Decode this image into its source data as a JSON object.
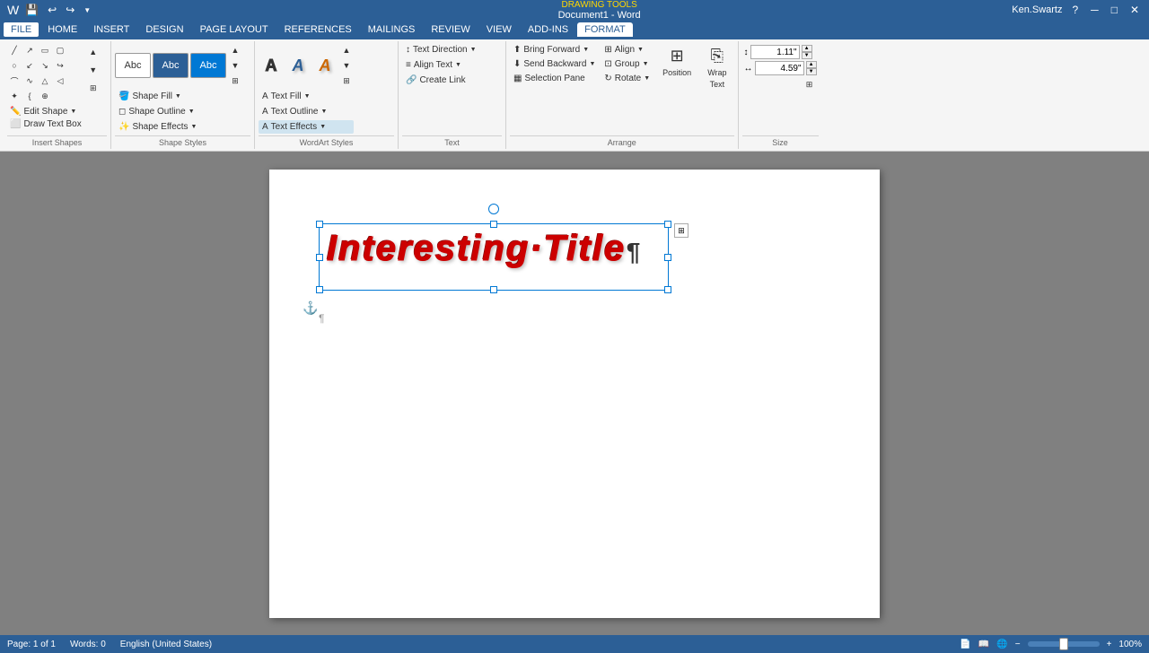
{
  "title_bar": {
    "document_title": "Document1 - Word",
    "drawing_tools_label": "DRAWING TOOLS",
    "user_name": "Ken.Swartz",
    "minimize_label": "─",
    "maximize_label": "□",
    "close_label": "✕",
    "help_label": "?"
  },
  "quick_access": {
    "save_label": "💾",
    "undo_label": "↩",
    "redo_label": "↪",
    "more_label": "▼"
  },
  "menu": {
    "items": [
      "FILE",
      "HOME",
      "INSERT",
      "DESIGN",
      "PAGE LAYOUT",
      "REFERENCES",
      "MAILINGS",
      "REVIEW",
      "VIEW",
      "ADD-INS",
      "FORMAT"
    ]
  },
  "ribbon": {
    "insert_shapes": {
      "label": "Insert Shapes",
      "edit_shape_label": "Edit Shape",
      "draw_textbox_label": "Draw Text Box"
    },
    "shape_styles": {
      "label": "Shape Styles",
      "samples": [
        "Abc",
        "Abc",
        "Abc"
      ],
      "fill_label": "Shape Fill",
      "outline_label": "Shape Outline",
      "effects_label": "Shape Effects"
    },
    "wordart_styles": {
      "label": "WordArt Styles",
      "text_fill_label": "Text Fill",
      "text_outline_label": "Text Outline",
      "text_effects_label": "Text Effects"
    },
    "text": {
      "label": "Text",
      "direction_label": "Text Direction",
      "align_text_label": "Align Text",
      "create_link_label": "Create Link"
    },
    "arrange": {
      "label": "Arrange",
      "bring_forward_label": "Bring Forward",
      "send_backward_label": "Send Backward",
      "align_label": "Align",
      "group_label": "Group",
      "rotate_label": "Rotate",
      "selection_pane_label": "Selection Pane"
    },
    "size": {
      "label": "Size",
      "height_value": "1.11\"",
      "width_value": "4.59\""
    }
  },
  "canvas": {
    "textbox_content": "Interesting·Title",
    "para_mark": "¶"
  },
  "status_bar": {
    "page_info": "Page: 1 of 1",
    "word_count": "Words: 0",
    "language": "English (United States)"
  }
}
